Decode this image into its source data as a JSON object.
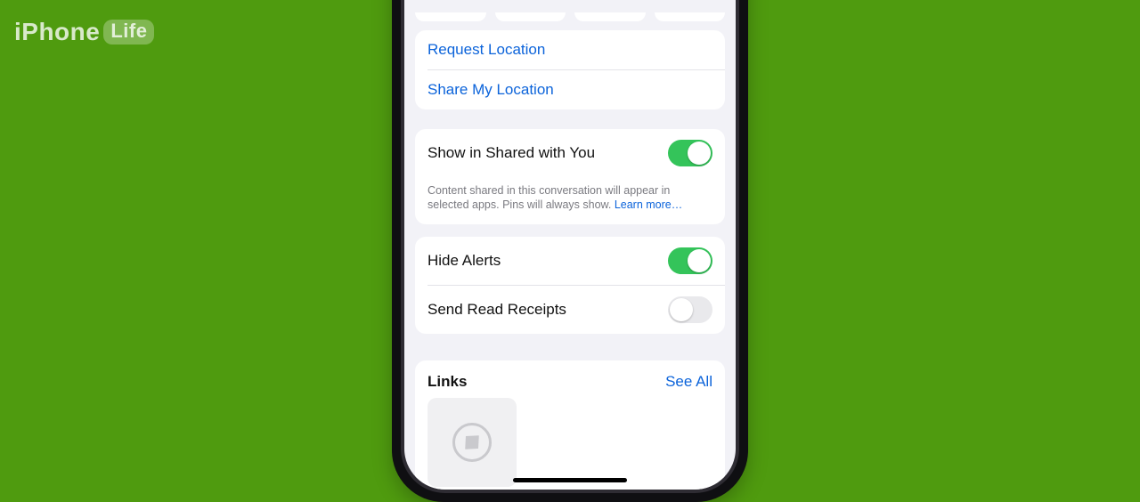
{
  "watermark": {
    "brand_left": "iPhone",
    "brand_pill": "Life"
  },
  "location_actions": {
    "request": "Request Location",
    "share": "Share My Location"
  },
  "shared_with_you": {
    "label": "Show in Shared with You",
    "footer_text": "Content shared in this conversation will appear in selected apps. Pins will always show. ",
    "learn_more": "Learn more…",
    "on": true
  },
  "alerts": {
    "hide_alerts_label": "Hide Alerts",
    "hide_alerts_on": true,
    "read_receipts_label": "Send Read Receipts",
    "read_receipts_on": false
  },
  "links": {
    "title": "Links",
    "see_all": "See All"
  },
  "colors": {
    "accent": "#0b63da",
    "toggle_on": "#34c45a",
    "page_bg": "#4f9b0f"
  }
}
